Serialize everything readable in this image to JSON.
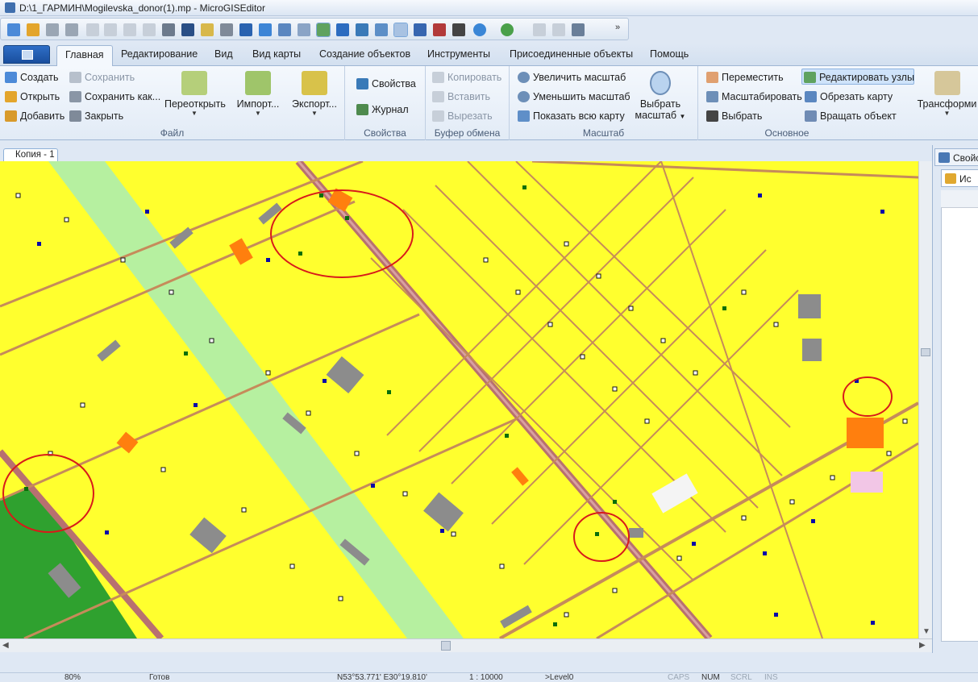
{
  "window": {
    "title": "D:\\1_ГАРМИН\\Mogilevska_donor(1).mp - MicroGISEditor"
  },
  "menu_tabs": [
    {
      "label": "Главная",
      "active": true
    },
    {
      "label": "Редактирование"
    },
    {
      "label": "Вид"
    },
    {
      "label": "Вид карты"
    },
    {
      "label": "Создание объектов"
    },
    {
      "label": "Инструменты"
    },
    {
      "label": "Присоединенные объекты"
    },
    {
      "label": "Помощь"
    }
  ],
  "ribbon": {
    "file": {
      "title": "Файл",
      "create": "Создать",
      "open": "Открыть",
      "add": "Добавить",
      "save": "Сохранить",
      "save_as": "Сохранить как...",
      "close": "Закрыть",
      "reopen": "Переоткрыть",
      "import": "Импорт...",
      "export": "Экспорт..."
    },
    "properties": {
      "title": "Свойства",
      "properties": "Свойства",
      "journal": "Журнал"
    },
    "clipboard": {
      "title": "Буфер обмена",
      "copy": "Копировать",
      "paste": "Вставить",
      "cut": "Вырезать"
    },
    "scale": {
      "title": "Масштаб",
      "zoom_in": "Увеличить масштаб",
      "zoom_out": "Уменьшить масштаб",
      "show_all": "Показать всю карту",
      "choose_scale": "Выбрать масштаб"
    },
    "basic": {
      "title": "Основное",
      "move": "Переместить",
      "scale_tool": "Масштабировать",
      "select": "Выбрать",
      "edit_nodes": "Редактировать узлы",
      "crop_map": "Обрезать карту",
      "rotate": "Вращать объект",
      "transform": "Трансформи"
    }
  },
  "document_tab": "Копия - 1",
  "right_panel": {
    "header": "Свойс",
    "tab": "Ис"
  },
  "status": {
    "zoom_percent": "80%",
    "state": "Готов",
    "coords": "N53°53.771' E30°19.810'",
    "scale": "1 : 10000",
    "level": ">Level0",
    "caps": "CAPS",
    "num": "NUM",
    "scrl": "SCRL",
    "ins": "INS"
  },
  "colors": {
    "map_background": "#ffff2e",
    "road_brown": "#c68b5a",
    "highway": "#b87070",
    "park_green": "#2fa12f",
    "lawn_green": "#b6f0a0",
    "building_gray": "#8c8c8c",
    "building_orange": "#ff7f0e",
    "node_blue": "#0a0aa8",
    "node_green": "#0a6e0a",
    "annotation_red": "#d81a1a",
    "ribbon_bg": "#e2ebf6",
    "app_button": "#1a4f9e"
  }
}
